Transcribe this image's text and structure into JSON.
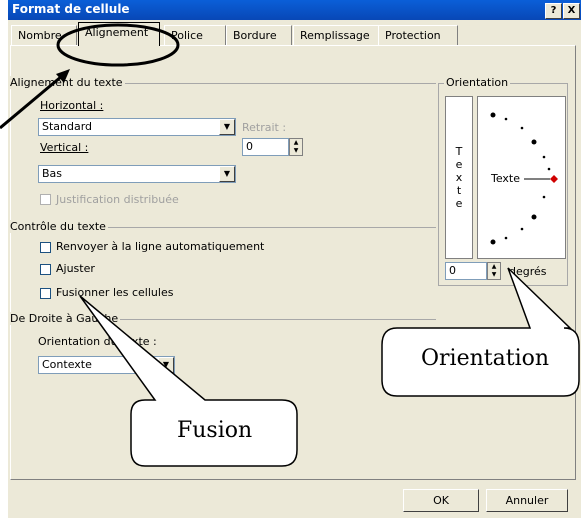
{
  "window": {
    "title": "Format de cellule",
    "help_label": "?",
    "close_label": "X"
  },
  "tabs": [
    {
      "label": "Nombre"
    },
    {
      "label": "Alignement"
    },
    {
      "label": "Police"
    },
    {
      "label": "Bordure"
    },
    {
      "label": "Remplissage"
    },
    {
      "label": "Protection"
    }
  ],
  "text_alignment": {
    "group_label": "Alignement du texte",
    "horizontal_label": "Horizontal :",
    "horizontal_value": "Standard",
    "indent_label": "Retrait :",
    "indent_value": "0",
    "vertical_label": "Vertical :",
    "vertical_value": "Bas",
    "distributed_label": "Justification distribuée"
  },
  "text_control": {
    "group_label": "Contrôle du texte",
    "wrap_label": "Renvoyer à la ligne automatiquement",
    "shrink_label": "Ajuster",
    "merge_label": "Fusionner les cellules"
  },
  "rtl": {
    "group_label": "De Droite à Gauche",
    "direction_label": "Orientation du texte :",
    "direction_value": "Contexte"
  },
  "orientation": {
    "group_label": "Orientation",
    "vertical_text": [
      "T",
      "e",
      "x",
      "t",
      "e"
    ],
    "dial_label": "Texte",
    "degrees_value": "0",
    "degrees_label": "degrés"
  },
  "callouts": {
    "orientation": "Orientation",
    "fusion": "Fusion"
  },
  "buttons": {
    "ok": "OK",
    "cancel": "Annuler"
  }
}
